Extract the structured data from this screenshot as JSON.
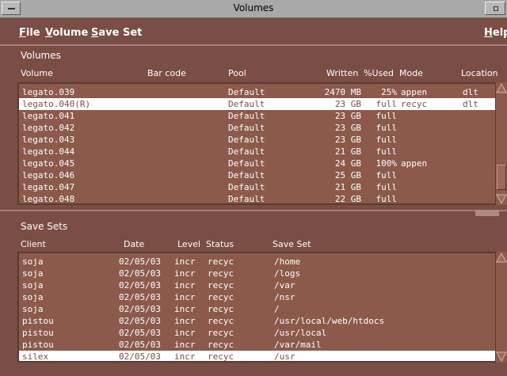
{
  "window": {
    "title": "Volumes"
  },
  "menu": {
    "file": "File",
    "volume": "Volume",
    "save_set": "Save Set",
    "help": "Help"
  },
  "volumes": {
    "label": "Volumes",
    "columns": {
      "volume": "Volume",
      "barcode": "Bar code",
      "pool": "Pool",
      "written": "Written",
      "used": "%Used",
      "mode": "Mode",
      "location": "Location"
    },
    "rows": [
      {
        "volume": "legato.039",
        "pool": "Default",
        "written": "2470 MB",
        "used": "25%",
        "mode": "appen",
        "location": "dlt"
      },
      {
        "volume": "legato.040(R)",
        "pool": "Default",
        "written": "23 GB",
        "used": "full",
        "mode": "recyc",
        "location": "dlt"
      },
      {
        "volume": "legato.041",
        "pool": "Default",
        "written": "23 GB",
        "used": "full",
        "mode": "",
        "location": ""
      },
      {
        "volume": "legato.042",
        "pool": "Default",
        "written": "23 GB",
        "used": "full",
        "mode": "",
        "location": ""
      },
      {
        "volume": "legato.043",
        "pool": "Default",
        "written": "23 GB",
        "used": "full",
        "mode": "",
        "location": ""
      },
      {
        "volume": "legato.044",
        "pool": "Default",
        "written": "21 GB",
        "used": "full",
        "mode": "",
        "location": ""
      },
      {
        "volume": "legato.045",
        "pool": "Default",
        "written": "24 GB",
        "used": "100%",
        "mode": "appen",
        "location": ""
      },
      {
        "volume": "legato.046",
        "pool": "Default",
        "written": "25 GB",
        "used": "full",
        "mode": "",
        "location": ""
      },
      {
        "volume": "legato.047",
        "pool": "Default",
        "written": "21 GB",
        "used": "full",
        "mode": "",
        "location": ""
      },
      {
        "volume": "legato.048",
        "pool": "Default",
        "written": "22 GB",
        "used": "full",
        "mode": "",
        "location": ""
      }
    ]
  },
  "savesets": {
    "label": "Save Sets",
    "columns": {
      "client": "Client",
      "date": "Date",
      "level": "Level",
      "status": "Status",
      "saveset": "Save Set"
    },
    "rows": [
      {
        "client": "soja",
        "date": "02/05/03",
        "level": "incr",
        "status": "recyc",
        "saveset": "/home"
      },
      {
        "client": "soja",
        "date": "02/05/03",
        "level": "incr",
        "status": "recyc",
        "saveset": "/logs"
      },
      {
        "client": "soja",
        "date": "02/05/03",
        "level": "incr",
        "status": "recyc",
        "saveset": "/var"
      },
      {
        "client": "soja",
        "date": "02/05/03",
        "level": "incr",
        "status": "recyc",
        "saveset": "/nsr"
      },
      {
        "client": "soja",
        "date": "02/05/03",
        "level": "incr",
        "status": "recyc",
        "saveset": "/"
      },
      {
        "client": "pistou",
        "date": "02/05/03",
        "level": "incr",
        "status": "recyc",
        "saveset": "/usr/local/web/htdocs"
      },
      {
        "client": "pistou",
        "date": "02/05/03",
        "level": "incr",
        "status": "recyc",
        "saveset": "/usr/local"
      },
      {
        "client": "pistou",
        "date": "02/05/03",
        "level": "incr",
        "status": "recyc",
        "saveset": "/var/mail"
      },
      {
        "client": "silex",
        "date": "02/05/03",
        "level": "incr",
        "status": "recyc",
        "saveset": "/usr"
      }
    ]
  }
}
